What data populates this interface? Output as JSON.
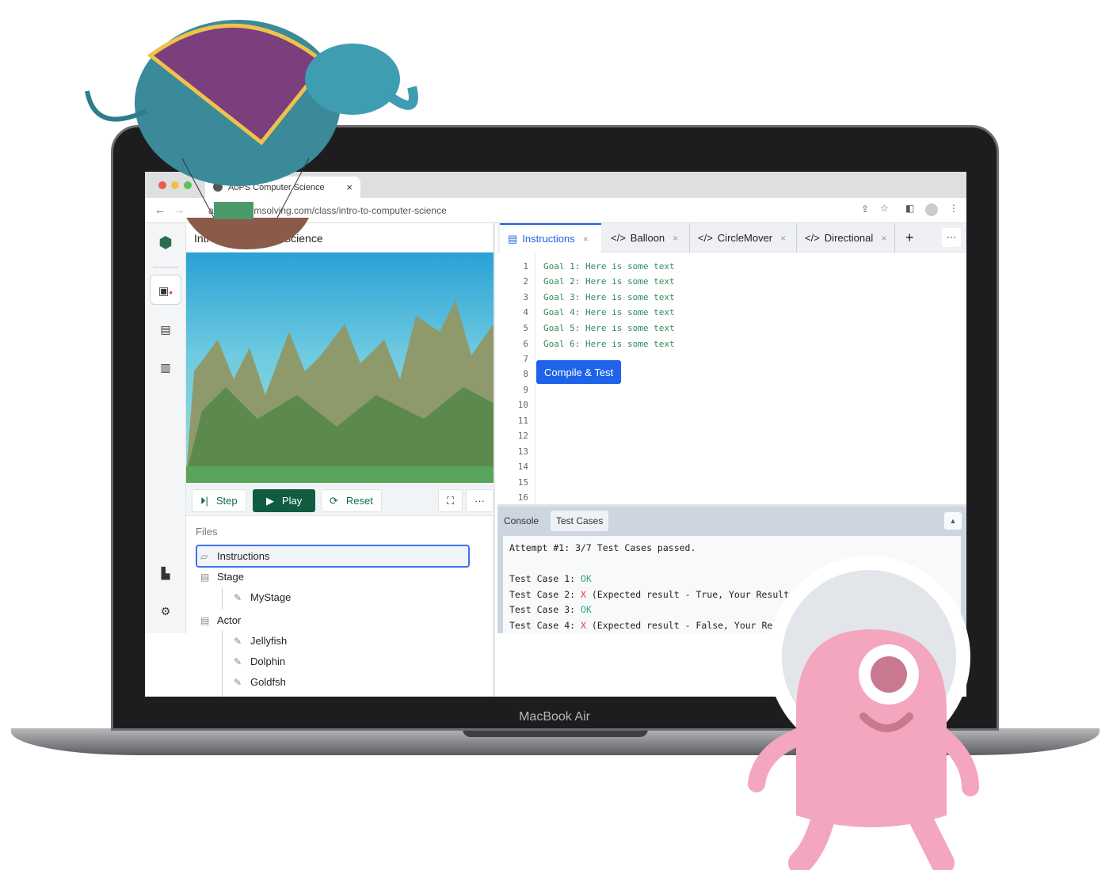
{
  "browser": {
    "tab_title": "AoPS Computer Science",
    "url": "artofproblemsolving.com/class/intro-to-computer-science"
  },
  "left_panel": {
    "title": "Intro to Computer Science"
  },
  "controls": {
    "step": "Step",
    "play": "Play",
    "reset": "Reset"
  },
  "files": {
    "heading": "Files",
    "items": [
      {
        "label": "Instructions",
        "level": 0,
        "selected": true
      },
      {
        "label": "Stage",
        "level": 0
      },
      {
        "label": "MyStage",
        "level": 1
      },
      {
        "label": "Actor",
        "level": 0
      },
      {
        "label": "Jellyfish",
        "level": 1
      },
      {
        "label": "Dolphin",
        "level": 1
      },
      {
        "label": "Goldfsh",
        "level": 1
      }
    ]
  },
  "editor": {
    "tabs": [
      {
        "label": "Instructions",
        "active": true
      },
      {
        "label": "Balloon"
      },
      {
        "label": "CircleMover"
      },
      {
        "label": "Directional"
      }
    ],
    "lines": [
      "Goal 1: Here is some text",
      "Goal 2: Here is some text",
      "Goal 3: Here is some text",
      "Goal 4: Here is some text",
      "Goal 5: Here is some text",
      "Goal 6: Here is some text"
    ],
    "line_numbers": [
      "1",
      "2",
      "3",
      "4",
      "5",
      "6",
      "7",
      "8",
      "9",
      "10",
      "11",
      "12",
      "13",
      "14",
      "15",
      "16"
    ],
    "compile_button": "Compile & Test"
  },
  "console": {
    "tabs": [
      "Console",
      "Test Cases"
    ],
    "summary": "Attempt #1: 3/7 Test Cases passed.",
    "cases": [
      {
        "label": "Test Case 1: ",
        "status": "OK",
        "detail": ""
      },
      {
        "label": "Test Case 2: ",
        "status": "X",
        "detail": " (Expected result - True, Your Result - False)"
      },
      {
        "label": "Test Case 3: ",
        "status": "OK",
        "detail": ""
      },
      {
        "label": "Test Case 4: ",
        "status": "X",
        "detail": " (Expected result - False, Your Result - Com"
      }
    ]
  },
  "device_label": "MacBook Air",
  "colors": {
    "accent": "#1e63e9",
    "play": "#0f5c40",
    "ok": "#3aa57a",
    "fail": "#e53b3b"
  }
}
